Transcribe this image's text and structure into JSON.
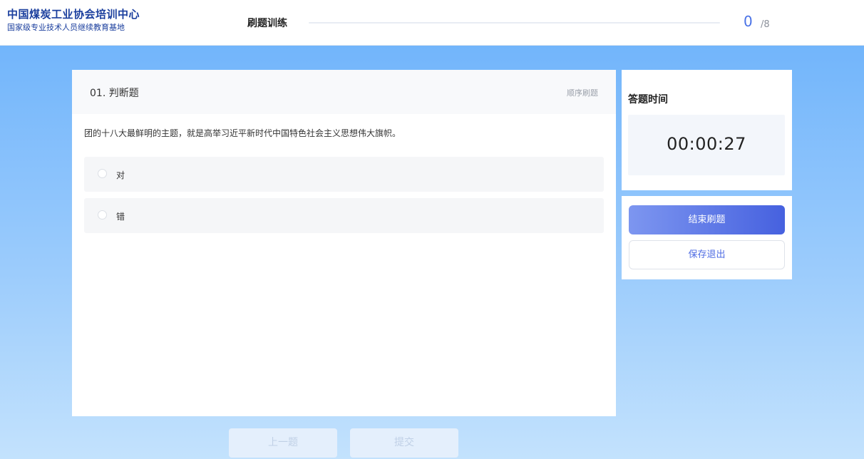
{
  "brand": {
    "title": "中国煤炭工业协会培训中心",
    "subtitle": "国家级专业技术人员继续教育基地"
  },
  "header": {
    "title": "刷题训练",
    "progress_current": "0",
    "progress_total": "/8",
    "progress_fraction": 0
  },
  "question": {
    "type_label": "01. 判断题",
    "mode_label": "顺序刷题",
    "text": "团的十八大最鲜明的主题，就是高举习近平新时代中国特色社会主义思想伟大旗帜。",
    "options": [
      {
        "label": "对",
        "selected": false
      },
      {
        "label": "错",
        "selected": false
      }
    ]
  },
  "timer": {
    "title": "答题时间",
    "value": "00:00:27"
  },
  "actions": {
    "end_label": "结束刷题",
    "save_label": "保存退出"
  },
  "nav": {
    "prev_label": "上一题",
    "submit_label": "提交"
  },
  "colors": {
    "brand": "#1b3f9e",
    "accent": "#4a72e6",
    "background_top": "#72b5fb",
    "background_bottom": "#c3e2fd"
  }
}
